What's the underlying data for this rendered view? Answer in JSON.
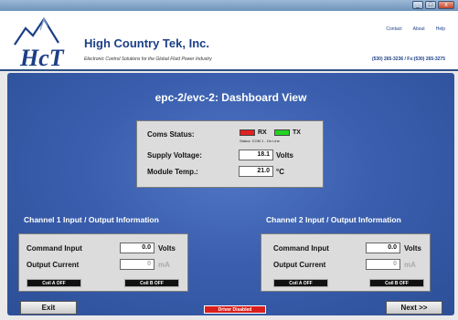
{
  "window": {
    "min": "_",
    "max": "□",
    "close": "x"
  },
  "header": {
    "logo_text": "HCT",
    "brand": "High Country Tek, Inc.",
    "tagline": "Electronic Control Solutions for the Global Fluid Power Industry",
    "links": [
      "Contact",
      "About",
      "Help"
    ],
    "phone": "(530) 265-3236 / Fx:(530) 265-3275"
  },
  "view_title": "epc-2/evc-2: Dashboard View",
  "status": {
    "coms_label": "Coms Status:",
    "rx_label": "RX",
    "tx_label": "TX",
    "rx_color": "#e02020",
    "tx_color": "#22d422",
    "status_line": "Status: COM 1 - On Line",
    "supply_label": "Supply Voltage:",
    "supply_value": "18.1",
    "supply_unit": "Volts",
    "temp_label": "Module Temp.:",
    "temp_value": "21.0",
    "temp_unit": "°C"
  },
  "channel1": {
    "title": "Channel 1 Input / Output Information",
    "command_label": "Command Input",
    "command_value": "0.0",
    "command_unit": "Volts",
    "current_label": "Output Current",
    "current_value": "0",
    "current_unit": "mA",
    "coil_a": "Coil A OFF",
    "coil_b": "Coil B OFF"
  },
  "channel2": {
    "title": "Channel 2 Input / Output Information",
    "command_label": "Command Input",
    "command_value": "0.0",
    "command_unit": "Volts",
    "current_label": "Output Current",
    "current_value": "0",
    "current_unit": "mA",
    "coil_a": "Coil A OFF",
    "coil_b": "Coil B OFF"
  },
  "footer": {
    "exit_label": "Exit",
    "driver_label": "Driver Disabled",
    "next_label": "Next >>"
  }
}
